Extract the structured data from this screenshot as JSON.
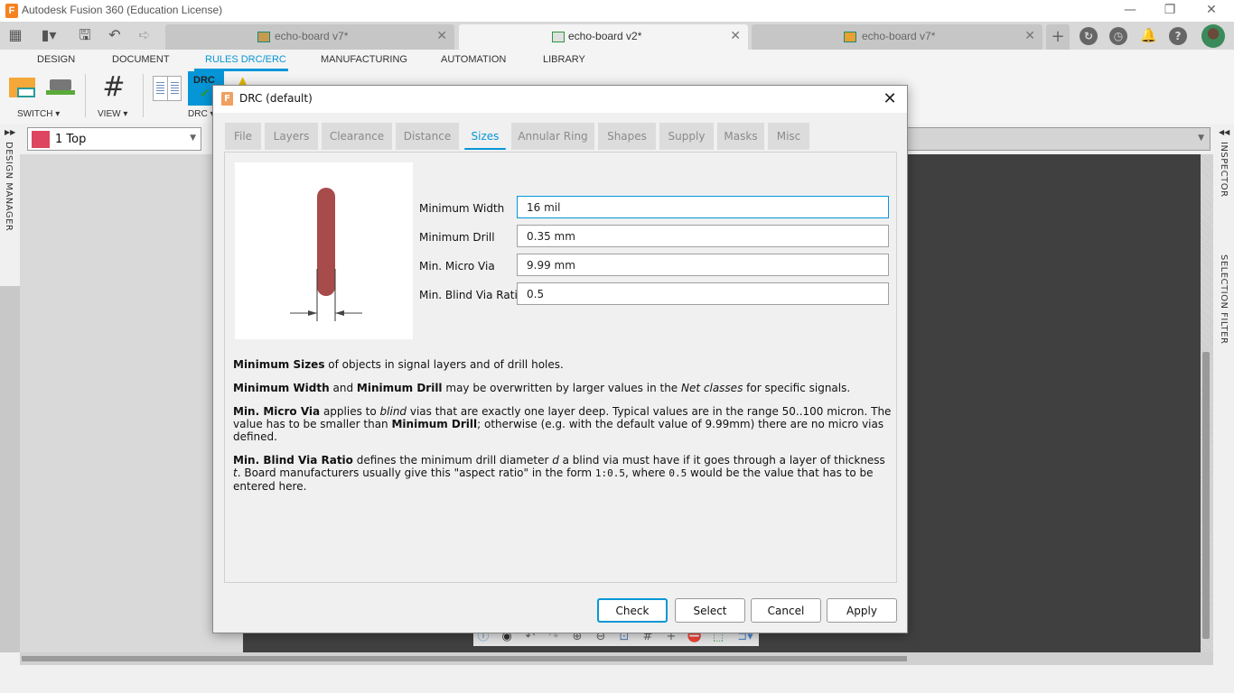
{
  "window": {
    "title": "Autodesk Fusion 360 (Education License)",
    "controls": {
      "minimize": "—",
      "restore": "❐",
      "close": "✕"
    }
  },
  "quick_access": {
    "icons": [
      "apps-grid-icon",
      "file-menu-icon",
      "save-icon",
      "undo-icon",
      "redo-icon"
    ]
  },
  "doc_tabs": [
    {
      "label": "echo-board v7*",
      "active": false
    },
    {
      "label": "echo-board v2*",
      "active": true
    },
    {
      "label": "echo-board v7*",
      "active": false
    }
  ],
  "header_icons": [
    "new-tab-icon",
    "job-status-icon",
    "history-icon",
    "notifications-icon",
    "help-icon",
    "user-avatar"
  ],
  "ribbon": {
    "tabs": [
      {
        "label": "DESIGN",
        "active": false
      },
      {
        "label": "DOCUMENT",
        "active": false
      },
      {
        "label": "RULES DRC/ERC",
        "active": true
      },
      {
        "label": "MANUFACTURING",
        "active": false
      },
      {
        "label": "AUTOMATION",
        "active": false
      },
      {
        "label": "LIBRARY",
        "active": false
      }
    ],
    "groups": [
      {
        "label": "SWITCH ▾"
      },
      {
        "label": "VIEW ▾"
      },
      {
        "label": "DRC ▾"
      }
    ],
    "drc_button_text": "DRC"
  },
  "layer_select": {
    "value": "1 Top",
    "color": "#dd4560"
  },
  "side_panels": {
    "left": "DESIGN MANAGER",
    "right_top": "INSPECTOR",
    "right_bottom": "SELECTION FILTER"
  },
  "dialog": {
    "title": "DRC (default)",
    "close": "✕",
    "tabs": [
      {
        "label": "File",
        "active": false
      },
      {
        "label": "Layers",
        "active": false
      },
      {
        "label": "Clearance",
        "active": false
      },
      {
        "label": "Distance",
        "active": false
      },
      {
        "label": "Sizes",
        "active": true
      },
      {
        "label": "Annular Ring",
        "active": false
      },
      {
        "label": "Shapes",
        "active": false
      },
      {
        "label": "Supply",
        "active": false
      },
      {
        "label": "Masks",
        "active": false
      },
      {
        "label": "Misc",
        "active": false
      }
    ],
    "fields": [
      {
        "label": "Minimum Width",
        "value": "16 mil"
      },
      {
        "label": "Minimum Drill",
        "value": "0.35 mm"
      },
      {
        "label": "Min. Micro Via",
        "value": "9.99 mm"
      },
      {
        "label": "Min. Blind Via Ratio",
        "value": "0.5"
      }
    ],
    "preview_trace_color": "#a84b4b",
    "help": {
      "p1": {
        "b1": "Minimum Sizes",
        "t1": " of objects in signal layers and of drill holes."
      },
      "p2": {
        "b1": "Minimum Width",
        "t1": " and ",
        "b2": "Minimum Drill",
        "t2": " may be overwritten by larger values in the ",
        "i1": "Net classes",
        "t3": " for specific signals."
      },
      "p3": {
        "b1": "Min. Micro Via",
        "t1": " applies to ",
        "i1": "blind",
        "t2": " vias that are exactly one layer deep. Typical values are in the range 50..100 micron. The value has to be smaller than ",
        "b2": "Minimum Drill",
        "t3": "; otherwise (e.g. with the default value of 9.99mm) there are no micro vias defined."
      },
      "p4": {
        "b1": "Min. Blind Via Ratio",
        "t1": " defines the minimum drill diameter ",
        "i1": "d",
        "t2": " a blind via must have if it goes through a layer of thickness ",
        "i2": "t",
        "t3": ". Board manufacturers usually give this \"aspect ratio\" in the form ",
        "c1": "1:0.5",
        "t4": ", where ",
        "c2": "0.5",
        "t5": " would be the value that has to be entered here."
      }
    },
    "buttons": {
      "check": "Check",
      "select": "Select",
      "cancel": "Cancel",
      "apply": "Apply"
    }
  },
  "nav_toolbar": [
    "info-icon",
    "eye-icon",
    "undo-icon",
    "redo-icon",
    "zoom-in-icon",
    "zoom-out-icon",
    "zoom-fit-icon",
    "grid-icon",
    "crosshair-icon",
    "stop-icon",
    "select-window-icon",
    "route-icon"
  ]
}
